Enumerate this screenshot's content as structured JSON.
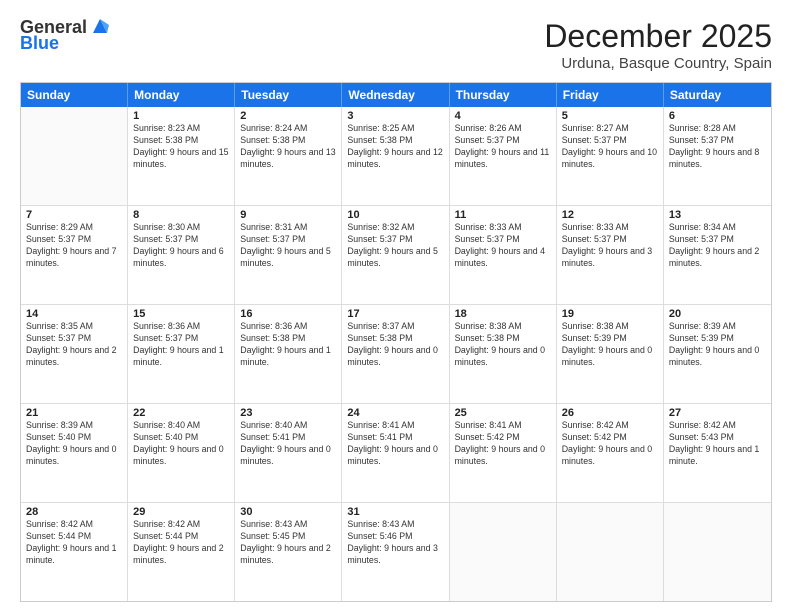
{
  "logo": {
    "general": "General",
    "blue": "Blue"
  },
  "header": {
    "title": "December 2025",
    "subtitle": "Urduna, Basque Country, Spain"
  },
  "weekdays": [
    "Sunday",
    "Monday",
    "Tuesday",
    "Wednesday",
    "Thursday",
    "Friday",
    "Saturday"
  ],
  "weeks": [
    [
      {
        "day": "",
        "sunrise": "",
        "sunset": "",
        "daylight": ""
      },
      {
        "day": "1",
        "sunrise": "Sunrise: 8:23 AM",
        "sunset": "Sunset: 5:38 PM",
        "daylight": "Daylight: 9 hours and 15 minutes."
      },
      {
        "day": "2",
        "sunrise": "Sunrise: 8:24 AM",
        "sunset": "Sunset: 5:38 PM",
        "daylight": "Daylight: 9 hours and 13 minutes."
      },
      {
        "day": "3",
        "sunrise": "Sunrise: 8:25 AM",
        "sunset": "Sunset: 5:38 PM",
        "daylight": "Daylight: 9 hours and 12 minutes."
      },
      {
        "day": "4",
        "sunrise": "Sunrise: 8:26 AM",
        "sunset": "Sunset: 5:37 PM",
        "daylight": "Daylight: 9 hours and 11 minutes."
      },
      {
        "day": "5",
        "sunrise": "Sunrise: 8:27 AM",
        "sunset": "Sunset: 5:37 PM",
        "daylight": "Daylight: 9 hours and 10 minutes."
      },
      {
        "day": "6",
        "sunrise": "Sunrise: 8:28 AM",
        "sunset": "Sunset: 5:37 PM",
        "daylight": "Daylight: 9 hours and 8 minutes."
      }
    ],
    [
      {
        "day": "7",
        "sunrise": "Sunrise: 8:29 AM",
        "sunset": "Sunset: 5:37 PM",
        "daylight": "Daylight: 9 hours and 7 minutes."
      },
      {
        "day": "8",
        "sunrise": "Sunrise: 8:30 AM",
        "sunset": "Sunset: 5:37 PM",
        "daylight": "Daylight: 9 hours and 6 minutes."
      },
      {
        "day": "9",
        "sunrise": "Sunrise: 8:31 AM",
        "sunset": "Sunset: 5:37 PM",
        "daylight": "Daylight: 9 hours and 5 minutes."
      },
      {
        "day": "10",
        "sunrise": "Sunrise: 8:32 AM",
        "sunset": "Sunset: 5:37 PM",
        "daylight": "Daylight: 9 hours and 5 minutes."
      },
      {
        "day": "11",
        "sunrise": "Sunrise: 8:33 AM",
        "sunset": "Sunset: 5:37 PM",
        "daylight": "Daylight: 9 hours and 4 minutes."
      },
      {
        "day": "12",
        "sunrise": "Sunrise: 8:33 AM",
        "sunset": "Sunset: 5:37 PM",
        "daylight": "Daylight: 9 hours and 3 minutes."
      },
      {
        "day": "13",
        "sunrise": "Sunrise: 8:34 AM",
        "sunset": "Sunset: 5:37 PM",
        "daylight": "Daylight: 9 hours and 2 minutes."
      }
    ],
    [
      {
        "day": "14",
        "sunrise": "Sunrise: 8:35 AM",
        "sunset": "Sunset: 5:37 PM",
        "daylight": "Daylight: 9 hours and 2 minutes."
      },
      {
        "day": "15",
        "sunrise": "Sunrise: 8:36 AM",
        "sunset": "Sunset: 5:37 PM",
        "daylight": "Daylight: 9 hours and 1 minute."
      },
      {
        "day": "16",
        "sunrise": "Sunrise: 8:36 AM",
        "sunset": "Sunset: 5:38 PM",
        "daylight": "Daylight: 9 hours and 1 minute."
      },
      {
        "day": "17",
        "sunrise": "Sunrise: 8:37 AM",
        "sunset": "Sunset: 5:38 PM",
        "daylight": "Daylight: 9 hours and 0 minutes."
      },
      {
        "day": "18",
        "sunrise": "Sunrise: 8:38 AM",
        "sunset": "Sunset: 5:38 PM",
        "daylight": "Daylight: 9 hours and 0 minutes."
      },
      {
        "day": "19",
        "sunrise": "Sunrise: 8:38 AM",
        "sunset": "Sunset: 5:39 PM",
        "daylight": "Daylight: 9 hours and 0 minutes."
      },
      {
        "day": "20",
        "sunrise": "Sunrise: 8:39 AM",
        "sunset": "Sunset: 5:39 PM",
        "daylight": "Daylight: 9 hours and 0 minutes."
      }
    ],
    [
      {
        "day": "21",
        "sunrise": "Sunrise: 8:39 AM",
        "sunset": "Sunset: 5:40 PM",
        "daylight": "Daylight: 9 hours and 0 minutes."
      },
      {
        "day": "22",
        "sunrise": "Sunrise: 8:40 AM",
        "sunset": "Sunset: 5:40 PM",
        "daylight": "Daylight: 9 hours and 0 minutes."
      },
      {
        "day": "23",
        "sunrise": "Sunrise: 8:40 AM",
        "sunset": "Sunset: 5:41 PM",
        "daylight": "Daylight: 9 hours and 0 minutes."
      },
      {
        "day": "24",
        "sunrise": "Sunrise: 8:41 AM",
        "sunset": "Sunset: 5:41 PM",
        "daylight": "Daylight: 9 hours and 0 minutes."
      },
      {
        "day": "25",
        "sunrise": "Sunrise: 8:41 AM",
        "sunset": "Sunset: 5:42 PM",
        "daylight": "Daylight: 9 hours and 0 minutes."
      },
      {
        "day": "26",
        "sunrise": "Sunrise: 8:42 AM",
        "sunset": "Sunset: 5:42 PM",
        "daylight": "Daylight: 9 hours and 0 minutes."
      },
      {
        "day": "27",
        "sunrise": "Sunrise: 8:42 AM",
        "sunset": "Sunset: 5:43 PM",
        "daylight": "Daylight: 9 hours and 1 minute."
      }
    ],
    [
      {
        "day": "28",
        "sunrise": "Sunrise: 8:42 AM",
        "sunset": "Sunset: 5:44 PM",
        "daylight": "Daylight: 9 hours and 1 minute."
      },
      {
        "day": "29",
        "sunrise": "Sunrise: 8:42 AM",
        "sunset": "Sunset: 5:44 PM",
        "daylight": "Daylight: 9 hours and 2 minutes."
      },
      {
        "day": "30",
        "sunrise": "Sunrise: 8:43 AM",
        "sunset": "Sunset: 5:45 PM",
        "daylight": "Daylight: 9 hours and 2 minutes."
      },
      {
        "day": "31",
        "sunrise": "Sunrise: 8:43 AM",
        "sunset": "Sunset: 5:46 PM",
        "daylight": "Daylight: 9 hours and 3 minutes."
      },
      {
        "day": "",
        "sunrise": "",
        "sunset": "",
        "daylight": ""
      },
      {
        "day": "",
        "sunrise": "",
        "sunset": "",
        "daylight": ""
      },
      {
        "day": "",
        "sunrise": "",
        "sunset": "",
        "daylight": ""
      }
    ]
  ]
}
